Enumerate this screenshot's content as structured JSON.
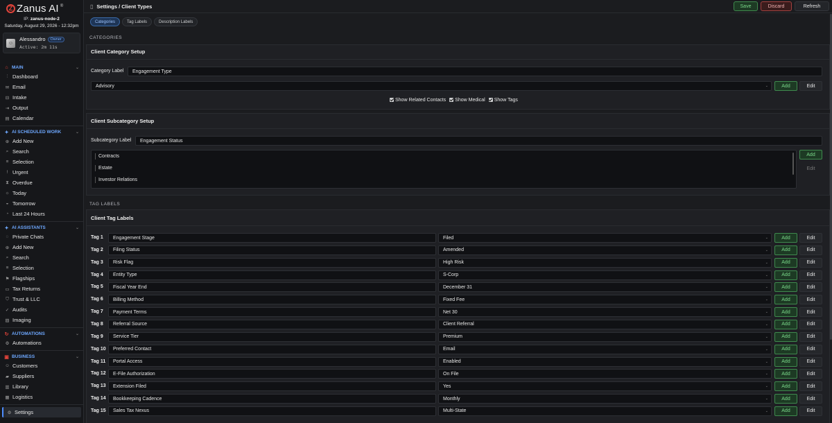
{
  "brand": {
    "name": "Zanus AI",
    "mark": "Z",
    "trademark": "®"
  },
  "server": {
    "ip_label": "IP:",
    "ip_value": "zanus-node-2"
  },
  "datetime": "Saturday, August 29, 2026 - 12:32pm",
  "user": {
    "name": "Alessandro",
    "role": "Owner",
    "active": "Active: 2m 11s"
  },
  "sidebar": {
    "sections": [
      {
        "title": "MAIN",
        "color": "#e0433a",
        "icon": "home-icon",
        "items": [
          {
            "label": "Dashboard",
            "icon": "chart-icon"
          },
          {
            "label": "Email",
            "icon": "mail-icon"
          },
          {
            "label": "Intake",
            "icon": "inbox-icon"
          },
          {
            "label": "Output",
            "icon": "output-icon"
          },
          {
            "label": "Calendar",
            "icon": "calendar-icon"
          }
        ]
      },
      {
        "title": "AI SCHEDULED WORK",
        "color": "#6ea8ff",
        "icon": "bolt-icon",
        "items": [
          {
            "label": "Add New",
            "icon": "plus-icon"
          },
          {
            "label": "Search",
            "icon": "search-icon"
          },
          {
            "label": "Selection",
            "icon": "selection-icon"
          },
          {
            "label": "Urgent",
            "icon": "alert-icon"
          },
          {
            "label": "Overdue",
            "icon": "hourglass-icon"
          },
          {
            "label": "Today",
            "icon": "sun-icon"
          },
          {
            "label": "Tomorrow",
            "icon": "sunrise-icon"
          },
          {
            "label": "Last 24 Hours",
            "icon": "clock-icon"
          }
        ]
      },
      {
        "title": "AI ASSISTANTS",
        "color": "#6ea8ff",
        "icon": "assistant-icon",
        "items": [
          {
            "label": "Private Chats",
            "icon": "chat-icon"
          },
          {
            "label": "Add New",
            "icon": "plus-icon"
          },
          {
            "label": "Search",
            "icon": "search-icon"
          },
          {
            "label": "Selection",
            "icon": "selection-icon"
          },
          {
            "label": "Flagships",
            "icon": "flag-icon"
          },
          {
            "label": "Tax Returns",
            "icon": "document-icon"
          },
          {
            "label": "Trust & LLC",
            "icon": "shield-icon"
          },
          {
            "label": "Audits",
            "icon": "audit-icon"
          },
          {
            "label": "Imaging",
            "icon": "image-icon"
          }
        ]
      },
      {
        "title": "AUTOMATIONS",
        "color": "#e0433a",
        "icon": "automation-icon",
        "items": [
          {
            "label": "Automations",
            "icon": "gear-icon"
          }
        ]
      },
      {
        "title": "BUSINESS",
        "color": "#e0433a",
        "icon": "briefcase-icon",
        "items": [
          {
            "label": "Customers",
            "icon": "users-icon"
          },
          {
            "label": "Suppliers",
            "icon": "truck-icon"
          },
          {
            "label": "Library",
            "icon": "book-icon"
          },
          {
            "label": "Logistics",
            "icon": "box-icon"
          }
        ]
      }
    ],
    "settings_label": "Settings"
  },
  "header": {
    "breadcrumb": "Settings / Client Types",
    "save": "Save",
    "discard": "Discard",
    "refresh": "Refresh"
  },
  "tabs": [
    "Categories",
    "Tag Labels",
    "Description Labels"
  ],
  "categories": {
    "section_title": "CATEGORIES",
    "category_setup": {
      "title": "Client Category Setup",
      "label_caption": "Category Label",
      "label_value": "Engagement Type",
      "selected": "Advisory",
      "add": "Add",
      "edit": "Edit",
      "checks": [
        "Show Related Contacts",
        "Show Medical",
        "Show Tags"
      ]
    },
    "subcategory_setup": {
      "title": "Client Subcategory Setup",
      "label_caption": "Subcategory Label",
      "label_value": "Engagement Status",
      "items": [
        "Contracts",
        "Estate",
        "Investor Relations"
      ],
      "add": "Add",
      "edit": "Edit"
    }
  },
  "tag_labels": {
    "section_title": "TAG LABELS",
    "panel_title": "Client Tag Labels",
    "add": "Add",
    "edit": "Edit",
    "rows": [
      {
        "tag": "Tag 1",
        "name": "Engagement Stage",
        "value": "Filed"
      },
      {
        "tag": "Tag 2",
        "name": "Filing Status",
        "value": "Amended"
      },
      {
        "tag": "Tag 3",
        "name": "Risk Flag",
        "value": "High Risk"
      },
      {
        "tag": "Tag 4",
        "name": "Entity Type",
        "value": "S-Corp"
      },
      {
        "tag": "Tag 5",
        "name": "Fiscal Year End",
        "value": "December 31"
      },
      {
        "tag": "Tag 6",
        "name": "Billing Method",
        "value": "Fixed Fee"
      },
      {
        "tag": "Tag 7",
        "name": "Payment Terms",
        "value": "Net 30"
      },
      {
        "tag": "Tag 8",
        "name": "Referral Source",
        "value": "Client Referral"
      },
      {
        "tag": "Tag 9",
        "name": "Service Tier",
        "value": "Premium"
      },
      {
        "tag": "Tag 10",
        "name": "Preferred Contact",
        "value": "Email"
      },
      {
        "tag": "Tag 11",
        "name": "Portal Access",
        "value": "Enabled"
      },
      {
        "tag": "Tag 12",
        "name": "E-File Authorization",
        "value": "On File"
      },
      {
        "tag": "Tag 13",
        "name": "Extension Filed",
        "value": "Yes"
      },
      {
        "tag": "Tag 14",
        "name": "Bookkeeping Cadence",
        "value": "Monthly"
      },
      {
        "tag": "Tag 15",
        "name": "Sales Tax Nexus",
        "value": "Multi-State"
      }
    ]
  }
}
